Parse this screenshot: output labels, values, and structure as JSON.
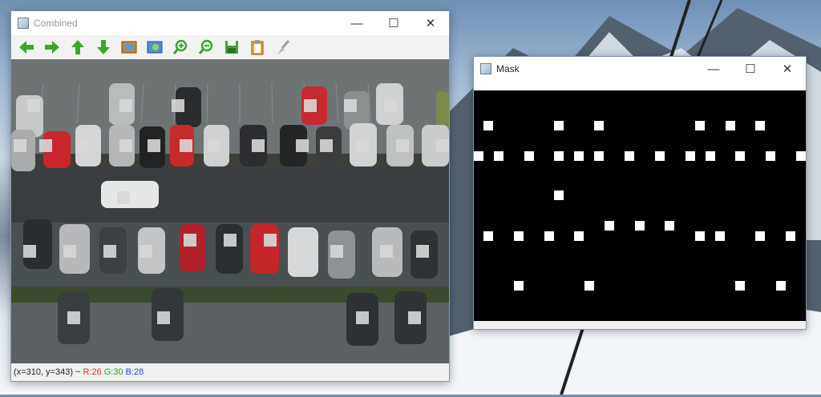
{
  "desktop": {
    "wallpaper_sky_color": "#8fa9c6",
    "wallpaper_snow_color": "#f4f7fa"
  },
  "combined_window": {
    "title": "Combined",
    "controls": {
      "minimize": "—",
      "maximize": "☐",
      "close": "✕"
    },
    "toolbar_icons": [
      "arrow-left-icon",
      "arrow-right-icon",
      "arrow-up-icon",
      "arrow-down-icon",
      "image-icon",
      "image-adjust-icon",
      "zoom-in-icon",
      "zoom-out-icon",
      "save-icon",
      "clipboard-icon",
      "brush-icon"
    ],
    "status": {
      "coords": "(x=310, y=343) ~",
      "r": "R:26",
      "g": "G:30",
      "b": "B:28"
    },
    "overlay_text_color": "#ff2020"
  },
  "mask_window": {
    "title": "Mask",
    "controls": {
      "minimize": "—",
      "maximize": "☐",
      "close": "✕"
    }
  }
}
